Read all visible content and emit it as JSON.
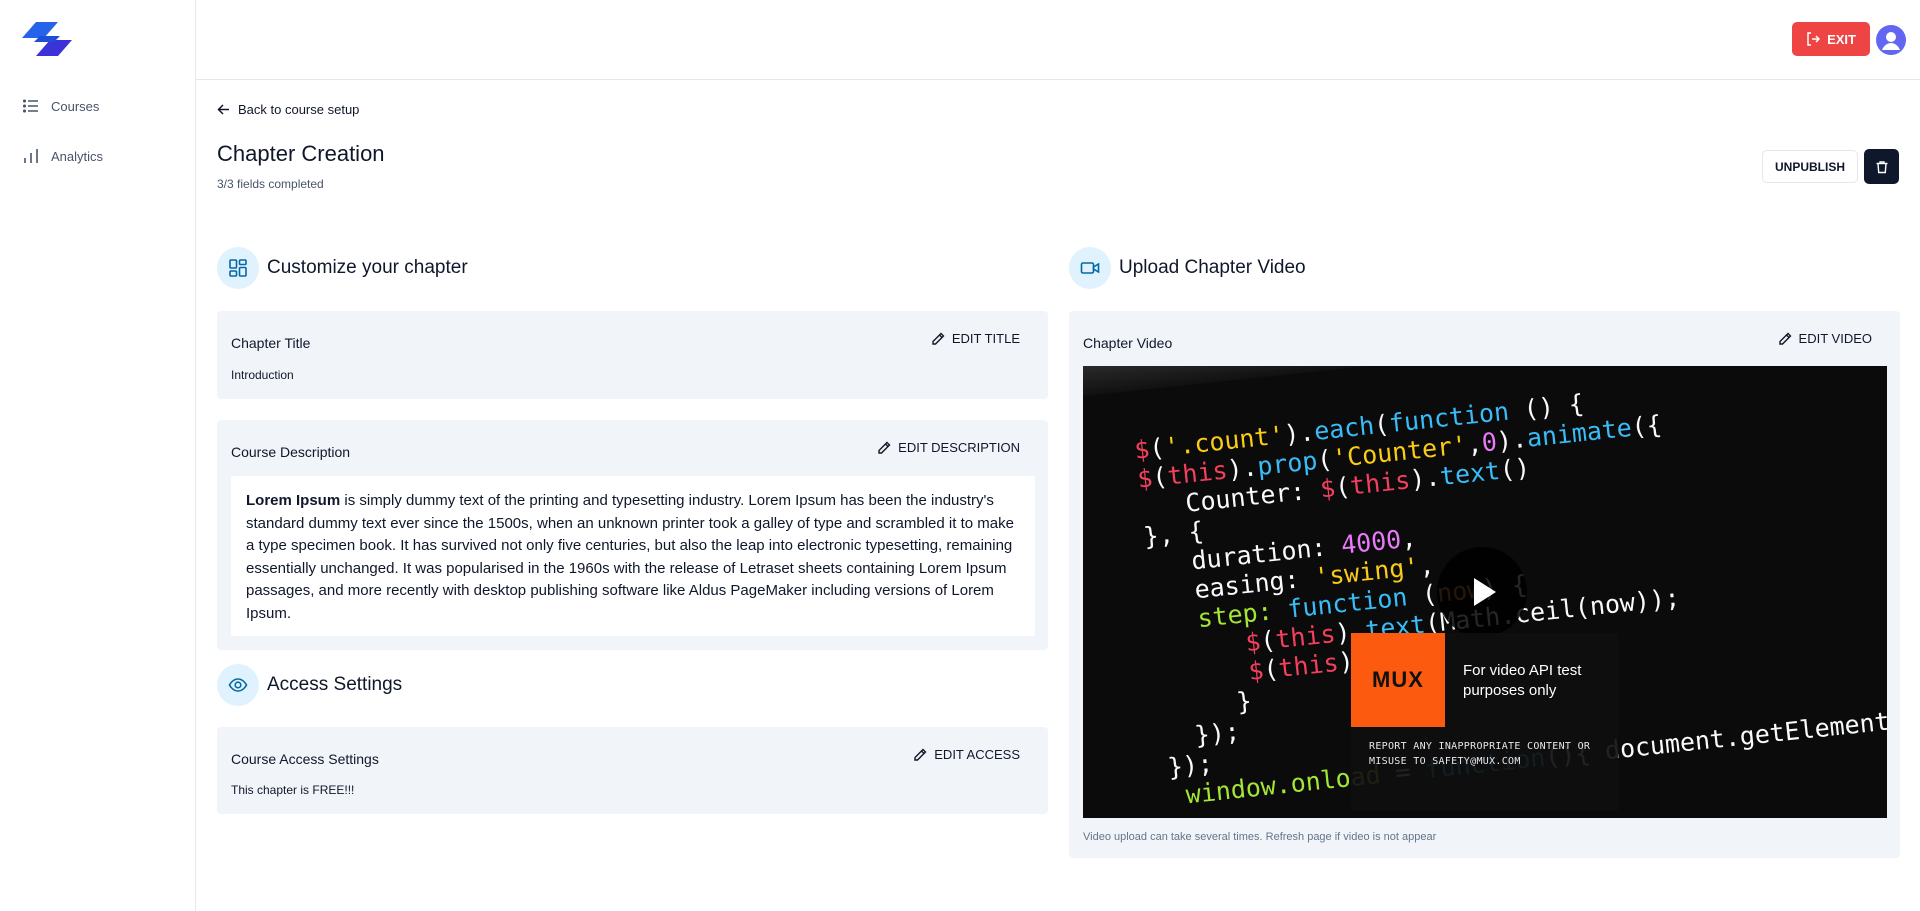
{
  "sidebar": {
    "items": [
      {
        "label": "Courses",
        "icon": "list-icon"
      },
      {
        "label": "Analytics",
        "icon": "bar-chart-icon"
      }
    ]
  },
  "topbar": {
    "exit_label": "EXIT"
  },
  "header": {
    "back_label": "Back to course setup",
    "title": "Chapter Creation",
    "subtitle": "3/3 fields completed",
    "unpublish_label": "UNPUBLISH"
  },
  "customize": {
    "title": "Customize your chapter",
    "chapter_title": {
      "label": "Chapter Title",
      "value": "Introduction",
      "edit_label": "EDIT TITLE"
    },
    "description": {
      "label": "Course Description",
      "edit_label": "EDIT DESCRIPTION",
      "bold": "Lorem Ipsum",
      "text": " is simply dummy text of the printing and typesetting industry. Lorem Ipsum has been the industry's standard dummy text ever since the 1500s, when an unknown printer took a galley of type and scrambled it to make a type specimen book. It has survived not only five centuries, but also the leap into electronic typesetting, remaining essentially unchanged. It was popularised in the 1960s with the release of Letraset sheets containing Lorem Ipsum passages, and more recently with desktop publishing software like Aldus PageMaker including versions of Lorem Ipsum."
    }
  },
  "access": {
    "title": "Access Settings",
    "label": "Course Access Settings",
    "edit_label": "EDIT ACCESS",
    "value": "This chapter is FREE!!!"
  },
  "video": {
    "title": "Upload Chapter Video",
    "label": "Chapter Video",
    "edit_label": "EDIT VIDEO",
    "mux_logo": "MUX",
    "mux_text": "For video API test purposes only",
    "mux_report": "REPORT ANY INAPPROPRIATE CONTENT OR MISUSE TO SAFETY@MUX.COM",
    "note": "Video upload can take several times. Refresh page if video is not appear"
  },
  "colors": {
    "accent": "#ef4444",
    "brand": "#2563eb",
    "dark": "#0f172a",
    "card": "#f1f5f9"
  }
}
